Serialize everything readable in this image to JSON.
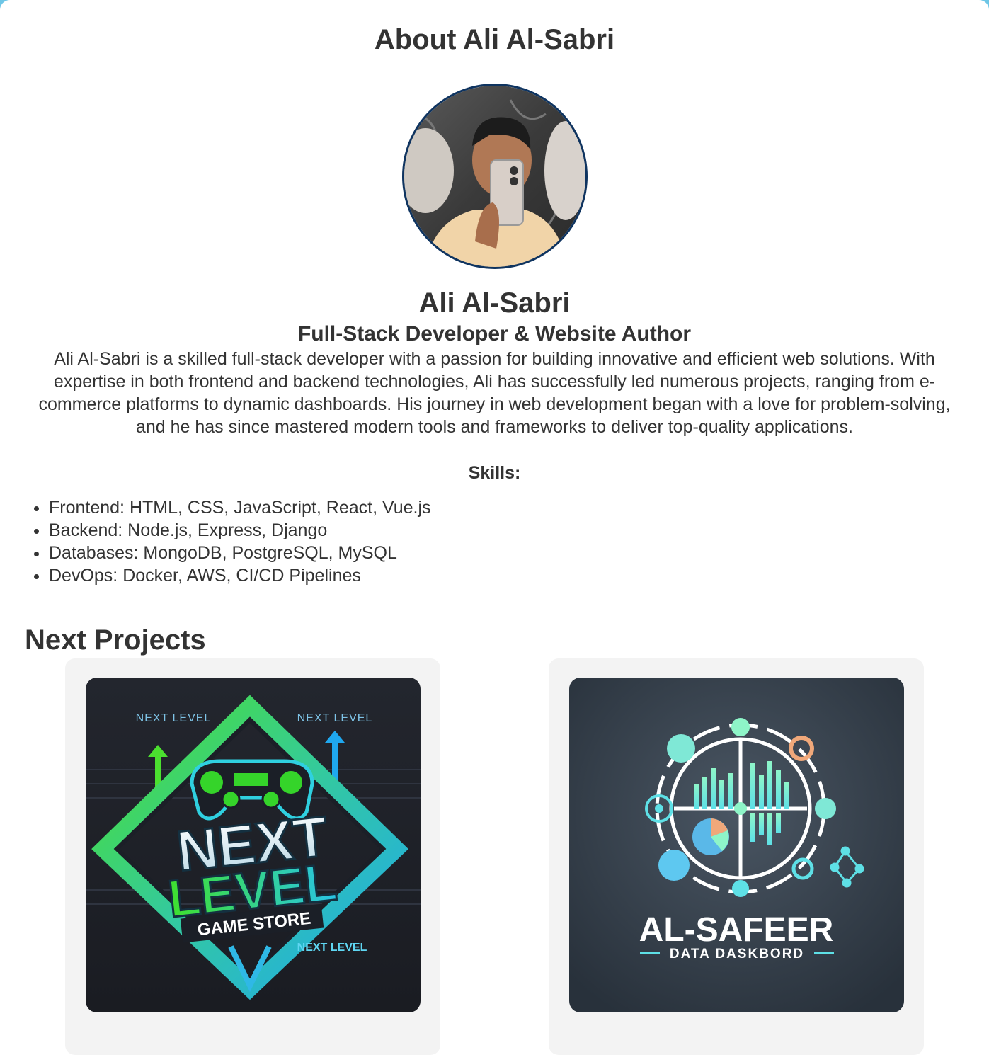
{
  "about": {
    "title": "About Ali Al-Sabri",
    "name": "Ali Al-Sabri",
    "role": "Full-Stack Developer & Website Author",
    "bio": "Ali Al-Sabri is a skilled full-stack developer with a passion for building innovative and efficient web solutions. With expertise in both frontend and backend technologies, Ali has successfully led numerous projects, ranging from e-commerce platforms to dynamic dashboards. His journey in web development began with a love for problem-solving, and he has since mastered modern tools and frameworks to deliver top-quality applications.",
    "skills_label": "Skills:",
    "skills": [
      "Frontend: HTML, CSS, JavaScript, React, Vue.js",
      "Backend: Node.js, Express, Django",
      "Databases: MongoDB, PostgreSQL, MySQL",
      "DevOps: Docker, AWS, CI/CD Pipelines"
    ]
  },
  "projects": {
    "title": "Next Projects",
    "items": [
      {
        "logo_tag_1": "NEXT LEVEL",
        "logo_tag_2": "NEXT LEVEL",
        "logo_word_1": "NEXT",
        "logo_word_2": "LEVEL",
        "logo_sub": "GAME STORE",
        "logo_tag_3": "NEXT LEVEL"
      },
      {
        "logo_title": "AL-SAFEER",
        "logo_sub": "DATA DASKBORD"
      }
    ]
  },
  "colors": {
    "background_frame": "#6ec6e6",
    "text": "#333333",
    "avatar_border": "#0f3460",
    "card_bg": "#f3f3f3"
  }
}
